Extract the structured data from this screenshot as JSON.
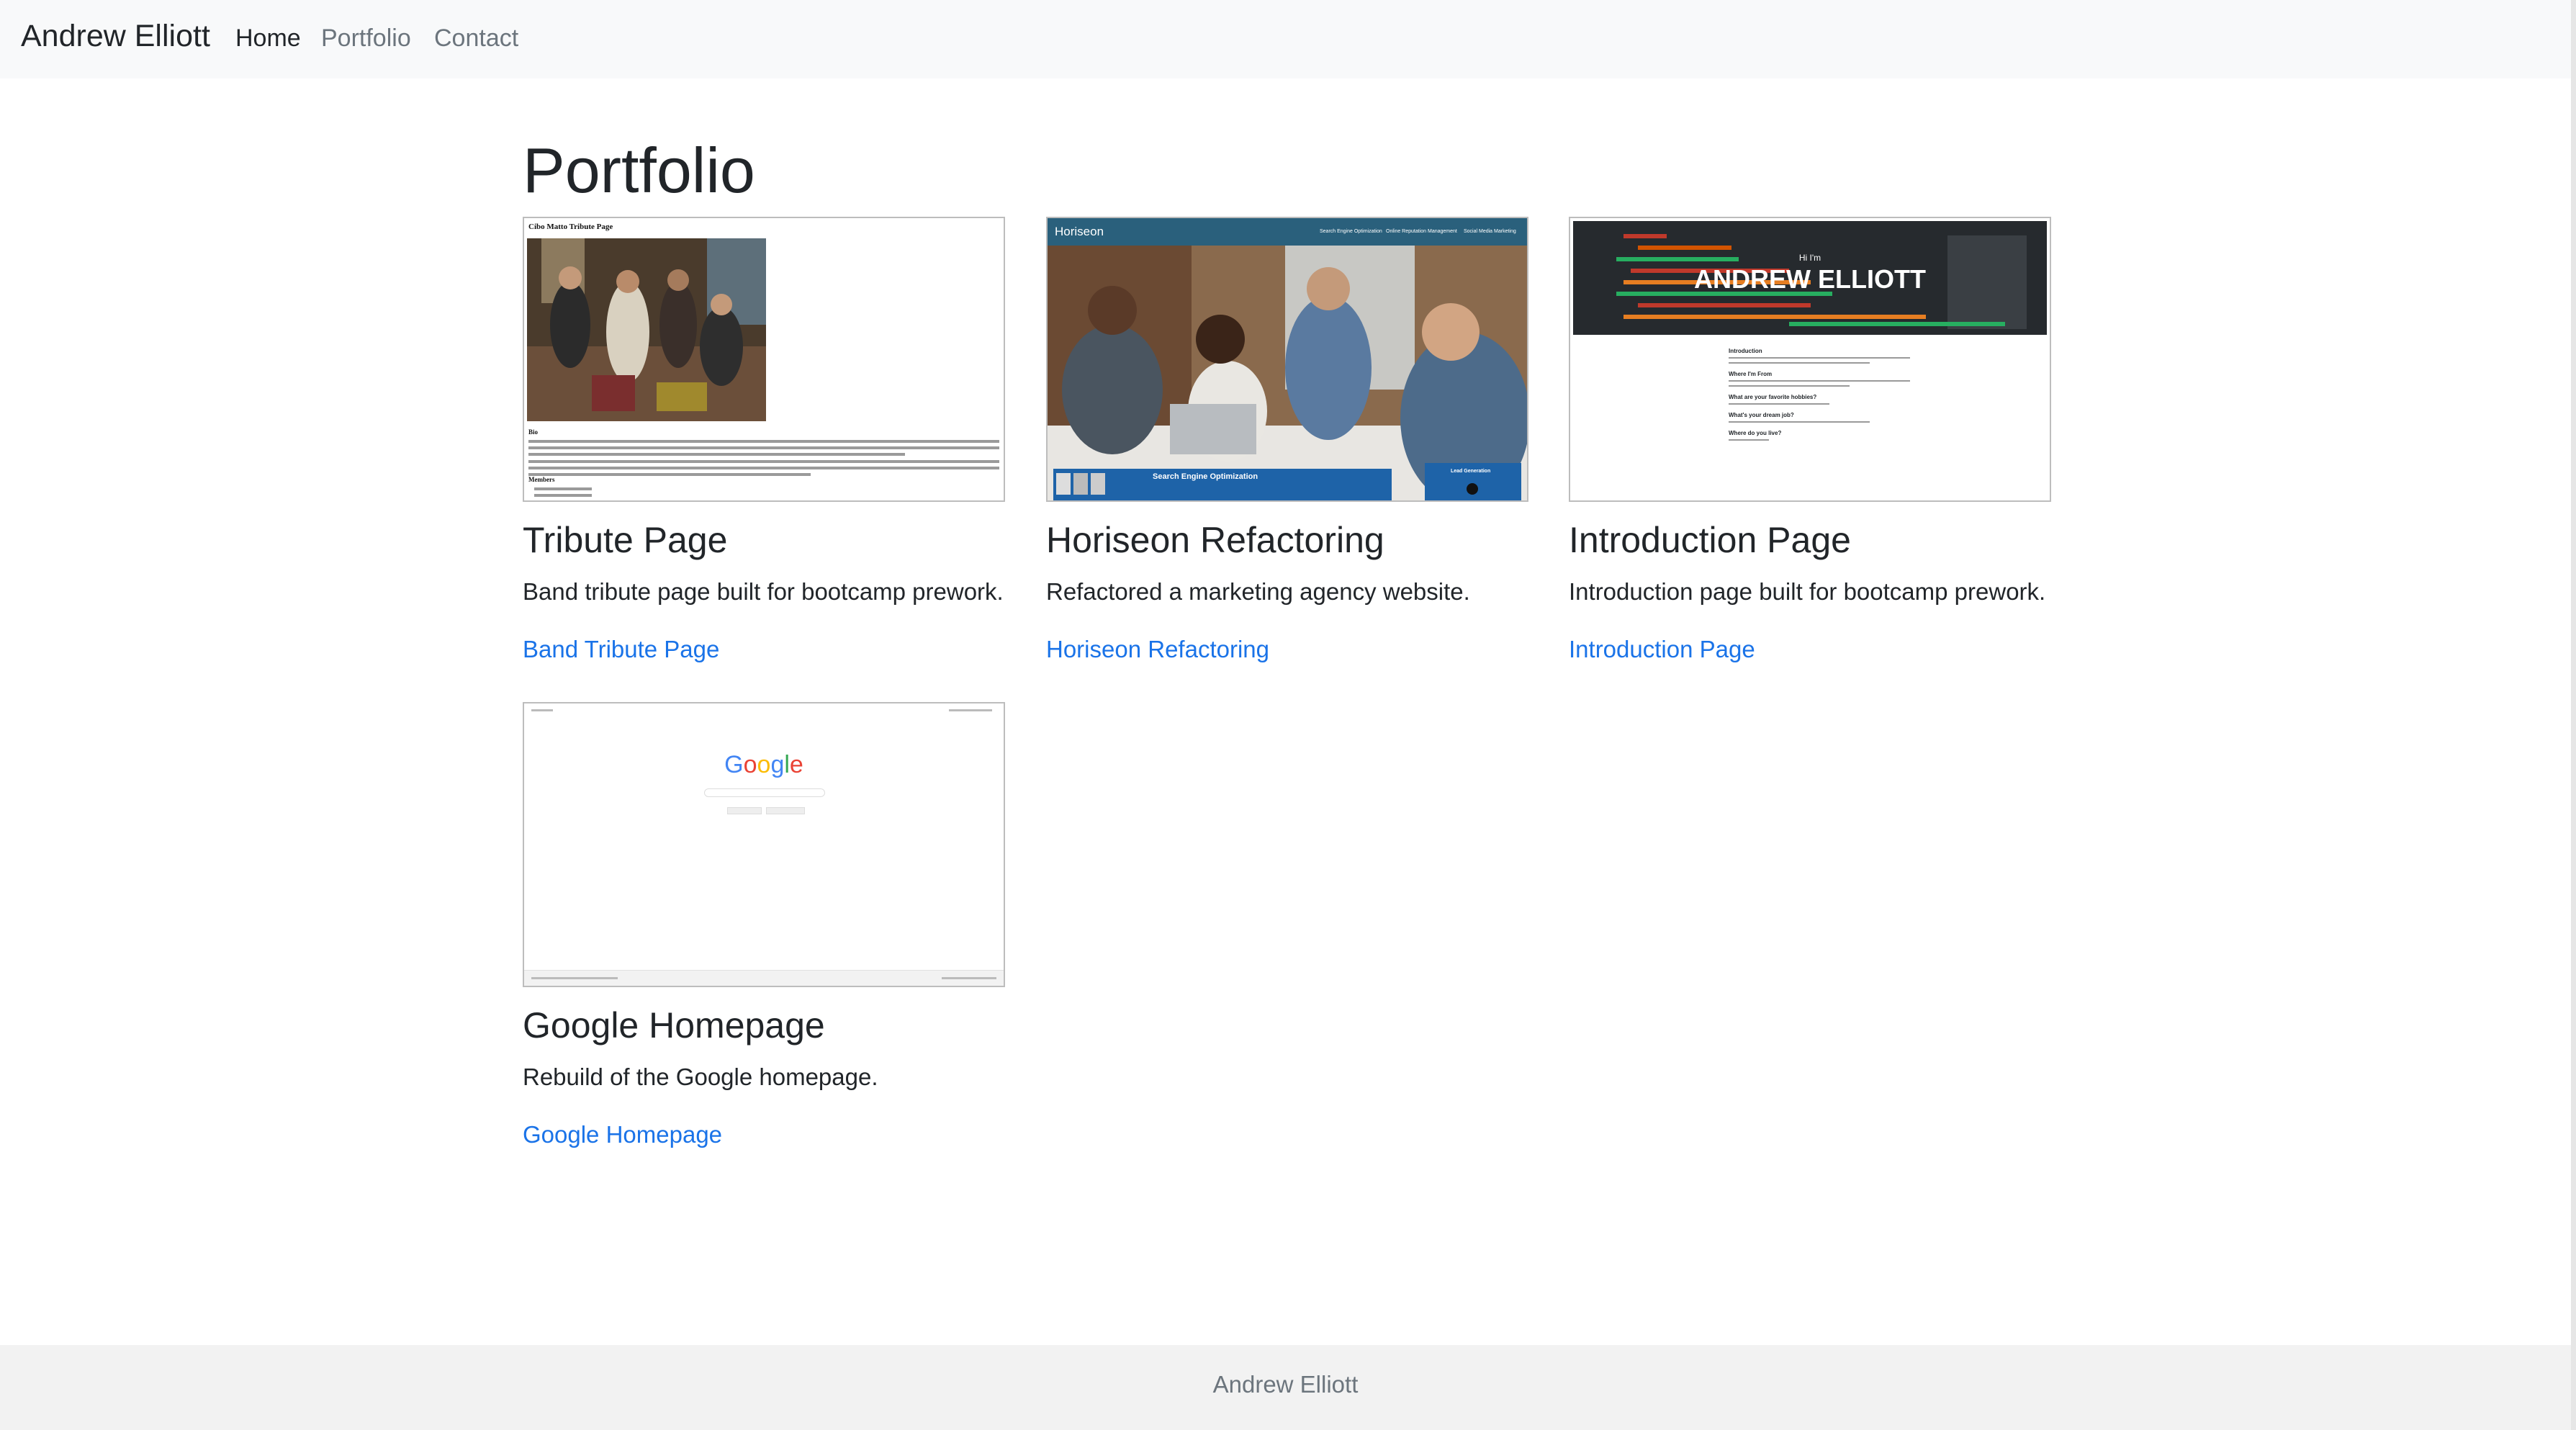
{
  "nav": {
    "brand": "Andrew Elliott",
    "links": [
      "Home",
      "Portfolio",
      "Contact"
    ]
  },
  "main": {
    "title": "Portfolio",
    "projects": [
      {
        "title": "Tribute Page",
        "description": "Band tribute page built for bootcamp prework.",
        "link": "Band Tribute Page",
        "thumb_heading": "Cibo Matto Tribute Page",
        "thumb_section": "Bio",
        "thumb_members": "Members"
      },
      {
        "title": "Horiseon Refactoring",
        "description": "Refactored a marketing agency website.",
        "link": "Horiseon Refactoring",
        "thumb_logo": "Horiseon",
        "thumb_nav": [
          "Search Engine Optimization",
          "Online Reputation Management",
          "Social Media Marketing"
        ],
        "thumb_banner": "Search Engine Optimization",
        "thumb_side": "Lead Generation"
      },
      {
        "title": "Introduction Page",
        "description": "Introduction page built for bootcamp prework.",
        "link": "Introduction Page",
        "thumb_hi": "Hi I'm",
        "thumb_name": "ANDREW ELLIOTT",
        "thumb_sections": [
          "Introduction",
          "Where I'm From",
          "What are your favorite hobbies?",
          "What's your dream job?",
          "Where do you live?"
        ]
      },
      {
        "title": "Google Homepage",
        "description": "Rebuild of the Google homepage.",
        "link": "Google Homepage",
        "thumb_logo_letters": [
          "G",
          "o",
          "o",
          "g",
          "l",
          "e"
        ],
        "thumb_logo_colors": [
          "#4285f4",
          "#ea4335",
          "#fbbc05",
          "#4285f4",
          "#34a853",
          "#ea4335"
        ]
      }
    ]
  },
  "footer": {
    "text": "Andrew Elliott"
  }
}
